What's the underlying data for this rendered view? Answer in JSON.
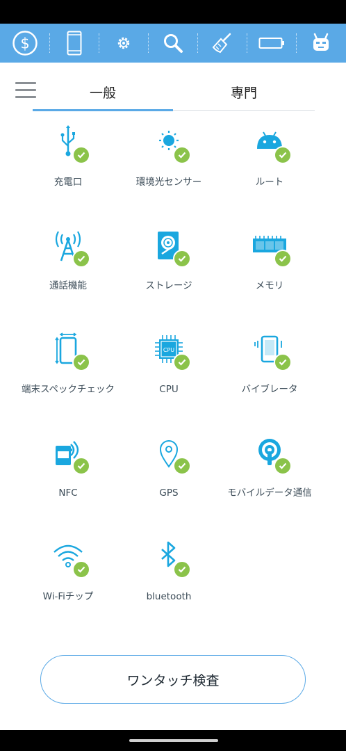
{
  "toolbar": {
    "items": [
      {
        "icon": "dollar-icon"
      },
      {
        "icon": "phone-icon"
      },
      {
        "icon": "gear-icon"
      },
      {
        "icon": "search-icon"
      },
      {
        "icon": "broom-icon"
      },
      {
        "icon": "battery-icon"
      },
      {
        "icon": "android-robot-icon"
      }
    ]
  },
  "tabs": {
    "general": "一般",
    "pro": "専門",
    "active": "general"
  },
  "colors": {
    "accent": "#5aa9e6",
    "icon": "#1aa7df",
    "check": "#8bc34a"
  },
  "checks": {
    "items": [
      {
        "label": "充電口",
        "icon": "usb-icon"
      },
      {
        "label": "環境光センサー",
        "icon": "light-sensor-icon"
      },
      {
        "label": "ルート",
        "icon": "android-root-icon"
      },
      {
        "label": "通話機能",
        "icon": "antenna-icon"
      },
      {
        "label": "ストレージ",
        "icon": "hard-disk-icon"
      },
      {
        "label": "メモリ",
        "icon": "memory-icon"
      },
      {
        "label": "端末スペックチェック",
        "icon": "device-spec-icon"
      },
      {
        "label": "CPU",
        "icon": "cpu-icon"
      },
      {
        "label": "バイブレータ",
        "icon": "vibration-icon"
      },
      {
        "label": "NFC",
        "icon": "nfc-icon"
      },
      {
        "label": "GPS",
        "icon": "gps-icon"
      },
      {
        "label": "モバイルデータ通信",
        "icon": "mobile-data-icon"
      },
      {
        "label": "Wi-Fiチップ",
        "icon": "wifi-icon"
      },
      {
        "label": "bluetooth",
        "icon": "bluetooth-icon"
      }
    ]
  },
  "action": {
    "one_touch_label": "ワンタッチ検査"
  }
}
